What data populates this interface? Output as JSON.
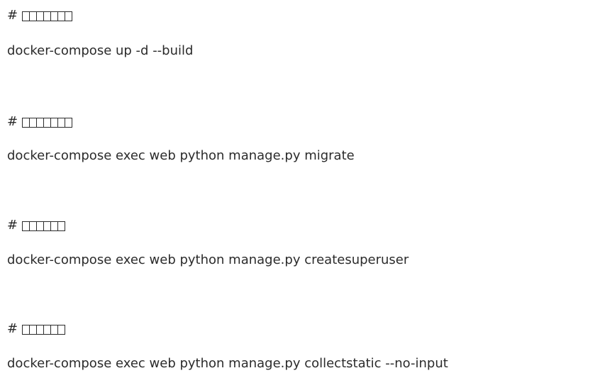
{
  "document": {
    "blocks": [
      {
        "comment_prefix": "#",
        "comment_glyph_count": 7,
        "command": "docker-compose up -d --build"
      },
      {
        "comment_prefix": "#",
        "comment_glyph_count": 7,
        "command": "docker-compose exec web python manage.py migrate"
      },
      {
        "comment_prefix": "#",
        "comment_glyph_count": 6,
        "command": "docker-compose exec web python manage.py createsuperuser"
      },
      {
        "comment_prefix": "#",
        "comment_glyph_count": 6,
        "command": "docker-compose exec web python manage.py collectstatic --no-input"
      }
    ]
  }
}
